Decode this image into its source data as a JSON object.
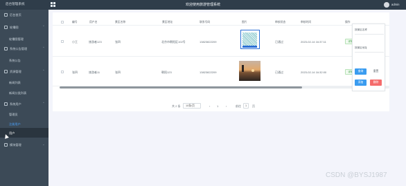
{
  "topbar": {
    "brand": "后台管理系统",
    "title": "欢迎使用旅游管理系统",
    "user": "admin"
  },
  "sidebar": {
    "items": [
      {
        "label": "后台首页",
        "icon": "home-icon"
      },
      {
        "label": "轮播图",
        "icon": "image-icon",
        "expandable": true
      },
      {
        "label": "轮播图管理",
        "sub": true
      },
      {
        "label": "系统公告管理",
        "icon": "notice-icon",
        "expandable": true
      },
      {
        "label": "系统公告",
        "sub": true
      },
      {
        "label": "资源管理",
        "icon": "folder-icon",
        "expandable": true
      },
      {
        "label": "新闻列表",
        "sub": true
      },
      {
        "label": "新闻分类列表",
        "sub": true
      },
      {
        "label": "系统用户",
        "icon": "user-icon",
        "expandable": true
      },
      {
        "label": "管理员",
        "sub": true
      },
      {
        "label": "注册用户",
        "sub": true,
        "active": true
      },
      {
        "label": "用户",
        "sub": true,
        "selected": true
      },
      {
        "label": "模块管理",
        "icon": "grid-icon",
        "expandable": true
      }
    ]
  },
  "table": {
    "headers": [
      "编号",
      "用户名",
      "景区名称",
      "景区地址",
      "联系号码",
      "图片",
      "审核状态",
      "审核时间",
      "操作"
    ],
    "rows": [
      {
        "id": "小王",
        "username": "旅游者123",
        "name": "张四",
        "address": "北京市朝阳区102号",
        "phone": "13823822209",
        "image": "qr",
        "status": "已通过",
        "time": "2023-02-14 16:37:11",
        "action": "详情"
      },
      {
        "id": "张四",
        "username": "旅游者11",
        "name": "张四",
        "address": "朝阳123",
        "phone": "13823822209",
        "image": "sunset",
        "status": "已通过",
        "time": "2023-02-14 16:32:00",
        "action": "详情"
      }
    ]
  },
  "pager": {
    "total": "共 2 条",
    "page_size": "10条/页",
    "prev": "‹",
    "page": "1",
    "next": "›",
    "goto_label": "前往",
    "goto_value": "1",
    "goto_suffix": "页"
  },
  "filter": {
    "label1": "按景区名称",
    "label2": "按景区地址",
    "search": "查询",
    "reset": "重置",
    "add": "添加",
    "delete": "删除"
  },
  "watermark": "CSDN @BYSJ1987",
  "colors": {
    "topbar": "#2f3d4a",
    "sidebar": "#3c4a57",
    "primary": "#3a9cf0",
    "danger": "#f56c6c",
    "success_tag": "#3ea046"
  }
}
